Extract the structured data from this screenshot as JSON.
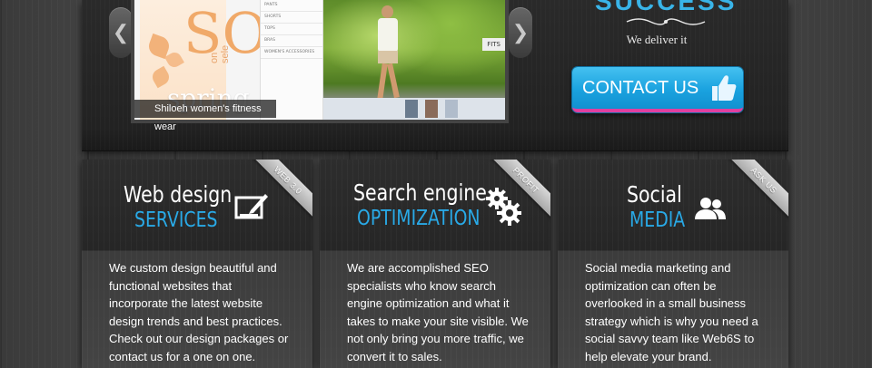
{
  "hero": {
    "slide_caption": "Shiloeh women's fitness wear",
    "slide_promo_big": "SO",
    "slide_promo_small": "on sele",
    "slide_promo_word": "spring",
    "slide_menu_items": [
      "PANTS",
      "SHORTS",
      "TOPS",
      "BRAS",
      "WOMEN'S ACCESSORIES"
    ],
    "slide_fits_label": "FITS",
    "headline": "SUCCESS",
    "tagline": "We deliver it",
    "contact_button": "CONTACT US",
    "accent_color": "#29a9e6"
  },
  "services": [
    {
      "ribbon": "WEB 3.0",
      "title_line1": "Web design",
      "title_line2": "SERVICES",
      "icon": "pen-tablet-icon",
      "description": "We custom design beautiful and functional websites that incorporate the latest website design trends and best practices. Check out our design packages or contact us for a one on one."
    },
    {
      "ribbon": "PROFIT",
      "title_line1": "Search engine",
      "title_line2": "OPTIMIZATION",
      "icon": "gears-icon",
      "description": "We are accomplished SEO specialists who know search engine optimization and what it takes to make your site visible. We not only bring you more traffic, we convert it to sales."
    },
    {
      "ribbon": "ASK US",
      "title_line1": "Social",
      "title_line2": "MEDIA",
      "icon": "users-icon",
      "description": "Social media marketing and optimization can often be overlooked in a small business strategy which is why you need a social savvy team like Web6S to help elevate your brand."
    }
  ]
}
